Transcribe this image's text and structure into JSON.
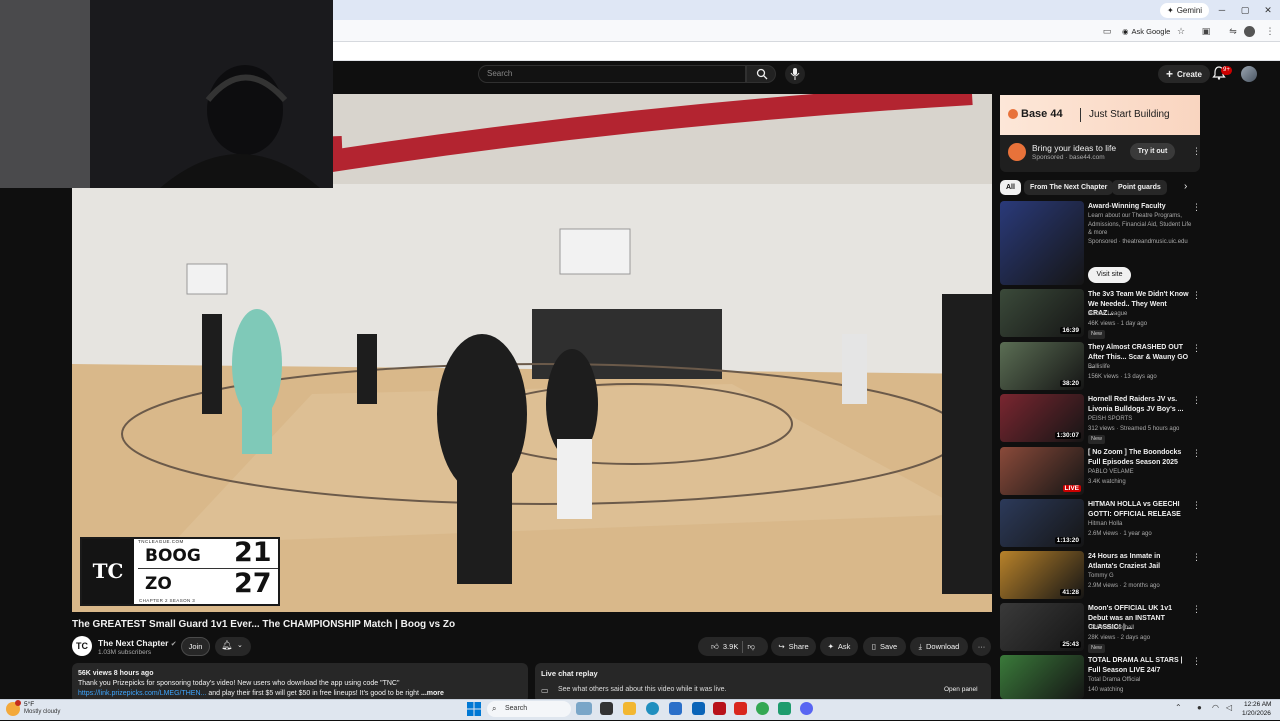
{
  "browser": {
    "gemini_label": "Gemini",
    "ask_google_label": "Ask Google"
  },
  "header": {
    "search_placeholder": "Search",
    "create_label": "Create",
    "notifications_badge": "9+"
  },
  "player": {
    "scoreboard": {
      "site": "TNCLEAGUE.COM",
      "season": "CHAPTER 2 SEASON 3",
      "logo": "TC",
      "team1": "BOOG",
      "score1": "21",
      "team2": "ZO",
      "score2": "27"
    }
  },
  "video": {
    "title": "The GREATEST Small Guard 1v1 Ever... The CHAMPIONSHIP Match | Boog vs Zo",
    "channel": "The Next Chapter",
    "subscribers": "1.03M subscribers",
    "join_label": "Join",
    "likes": "3.9K",
    "share_label": "Share",
    "ask_label": "Ask",
    "save_label": "Save",
    "download_label": "Download",
    "more": "···",
    "views_time": "56K views  8 hours ago",
    "description": "Thank you Prizepicks for sponsoring today's video! New users who download the app using code \"TNC\"",
    "desc_link": "https://link.prizepicks.com/LMEG/THEN...",
    "desc_rest": " and play their first $5 will get $50 in free lineups! It's good to be right",
    "desc_more": "...more",
    "chat_title": "Live chat replay",
    "chat_sub": "See what others said about this video while it was live.",
    "open_panel": "Open panel"
  },
  "sidebar": {
    "ad": {
      "logo": "Base 44",
      "tag": "Just Start Building",
      "headline": "Bring your ideas to life",
      "sponsor": "Sponsored · base44.com",
      "try_label": "Try it out"
    },
    "chips": [
      "All",
      "From The Next Chapter",
      "Point guards"
    ],
    "recs": [
      {
        "title": "Award-Winning Faculty",
        "desc": "Learn about our Theatre Programs, Admissions, Financial Aid, Student Life & more",
        "meta1": "Sponsored · theatreandmusic.uic.edu",
        "visit": "Visit site",
        "thumb": "#2a3a7a"
      },
      {
        "title": "The 3v3 Team We Didn't Know We Needed.. They Went CRAZ...",
        "meta1": "Jumes League",
        "meta2": "46K views · 1 day ago",
        "badge": "New",
        "duration": "16:39",
        "thumb": "#3b4a3a"
      },
      {
        "title": "They Almost CRASHED OUT After This... Scar & Wauny GO ...",
        "meta1": "Ballislife",
        "meta2": "156K views · 13 days ago",
        "duration": "38:20",
        "thumb": "#5b6e54"
      },
      {
        "title": "Hornell Red Raiders JV vs. Livonia Bulldogs JV Boy's ...",
        "meta1": "PEISH SPORTS",
        "meta2": "312 views · Streamed 5 hours ago",
        "badge": "New",
        "duration": "1:30:07",
        "thumb": "#7a2630"
      },
      {
        "title": "[ No Zoom ] The Boondocks Full Episodes Season 2025",
        "meta1": "PABLO VELAME",
        "meta2": "3.4K watching",
        "duration": "LIVE",
        "thumb": "#8a4a3a"
      },
      {
        "title": "HITMAN HOLLA vs GEECHI GOTTI: OFFICIAL RELEASE",
        "meta1": "Hitman Holla",
        "meta2": "2.6M views · 1 year ago",
        "duration": "1:13:20",
        "thumb": "#2c3a5a"
      },
      {
        "title": "24 Hours as Inmate in Atlanta's Craziest Jail",
        "meta1": "Tommy G",
        "meta2": "2.9M views · 2 months ago",
        "duration": "41:28",
        "thumb": "#b8822a"
      },
      {
        "title": "Moon's OFFICIAL UK 1v1 Debut was an INSTANT CLASSIC! | ...",
        "meta1": "UDFN Basketball",
        "meta2": "28K views · 2 days ago",
        "badge": "New",
        "duration": "25:43",
        "thumb": "#3a3a3a"
      },
      {
        "title": "TOTAL DRAMA ALL STARS | Full Season LIVE 24/7",
        "meta1": "Total Drama Official",
        "meta2": "140 watching",
        "duration": "",
        "thumb": "#3a7a3a"
      }
    ]
  },
  "taskbar": {
    "temp": "5°F",
    "weather": "Mostly cloudy",
    "search_label": "Search",
    "time": "12:26 AM",
    "date": "1/20/2026"
  }
}
